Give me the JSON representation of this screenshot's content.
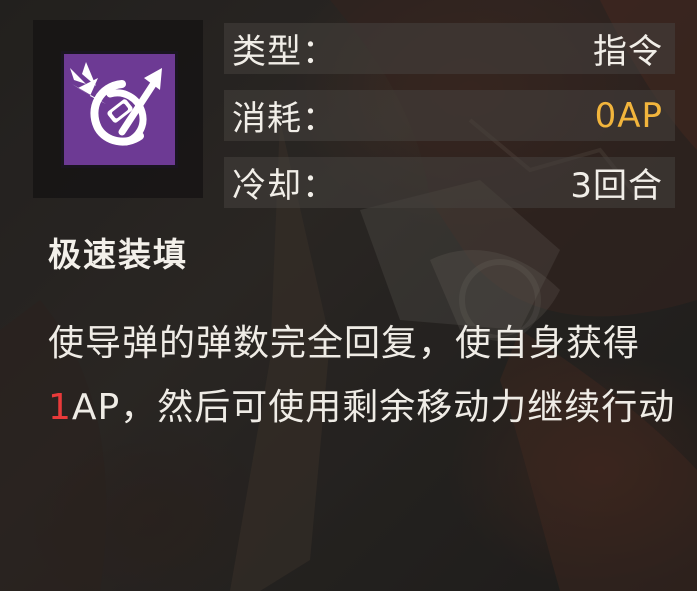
{
  "skill": {
    "icon": "rapid-reload-icon",
    "name": "极速装填",
    "stats": [
      {
        "label": "类型：",
        "value": "指令"
      },
      {
        "label": "消耗：",
        "value": "0AP"
      },
      {
        "label": "冷却：",
        "value": "3回合"
      }
    ],
    "description": {
      "part1": "使导弹的弹数完全回复，使自身获得",
      "highlight": "1",
      "part2": "AP，然后可使用剩余移动力继续行动"
    }
  },
  "colors": {
    "icon_tile": "#6d3a94",
    "cost_value": "#f2b53c",
    "highlight_number": "#e83a3a",
    "row_background": "#46423e"
  }
}
